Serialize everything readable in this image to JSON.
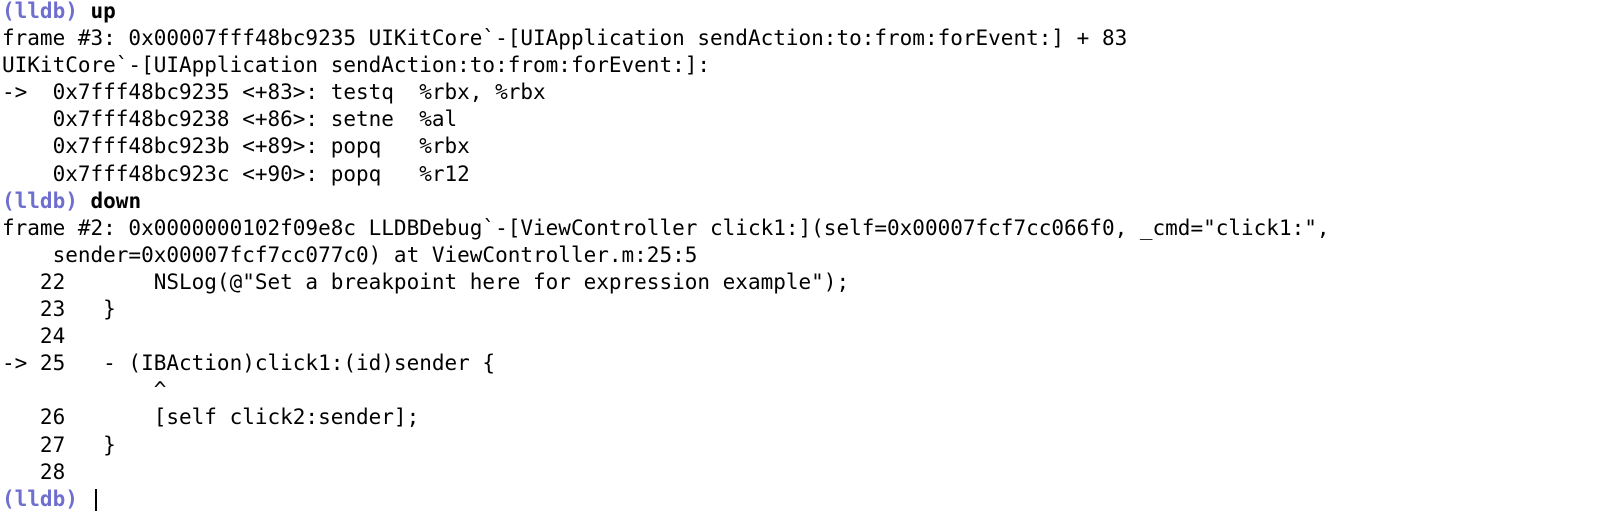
{
  "colors": {
    "prompt": "#6f6fcf",
    "text": "#000000",
    "background": "#ffffff"
  },
  "console": {
    "lines": [
      {
        "type": "prompt",
        "prompt": "(lldb)",
        "command": "up"
      },
      {
        "type": "output",
        "text": "frame #3: 0x00007fff48bc9235 UIKitCore`-[UIApplication sendAction:to:from:forEvent:] + 83"
      },
      {
        "type": "output",
        "text": "UIKitCore`-[UIApplication sendAction:to:from:forEvent:]:"
      },
      {
        "type": "output",
        "text": "->  0x7fff48bc9235 <+83>: testq  %rbx, %rbx"
      },
      {
        "type": "output",
        "text": "    0x7fff48bc9238 <+86>: setne  %al"
      },
      {
        "type": "output",
        "text": "    0x7fff48bc923b <+89>: popq   %rbx"
      },
      {
        "type": "output",
        "text": "    0x7fff48bc923c <+90>: popq   %r12"
      },
      {
        "type": "prompt",
        "prompt": "(lldb)",
        "command": "down"
      },
      {
        "type": "output",
        "text": "frame #2: 0x0000000102f09e8c LLDBDebug`-[ViewController click1:](self=0x00007fcf7cc066f0, _cmd=\"click1:\","
      },
      {
        "type": "output",
        "text": "    sender=0x00007fcf7cc077c0) at ViewController.m:25:5"
      },
      {
        "type": "output",
        "text": "   22   \t    NSLog(@\"Set a breakpoint here for expression example\");"
      },
      {
        "type": "output",
        "text": "   23   \t}"
      },
      {
        "type": "output",
        "text": "   24   \t"
      },
      {
        "type": "output",
        "text": "-> 25   \t- (IBAction)click1:(id)sender {"
      },
      {
        "type": "output",
        "text": "        \t    ^"
      },
      {
        "type": "output",
        "text": "   26   \t    [self click2:sender];"
      },
      {
        "type": "output",
        "text": "   27   \t}"
      },
      {
        "type": "output",
        "text": "   28   \t"
      },
      {
        "type": "prompt",
        "prompt": "(lldb)",
        "command": ""
      }
    ]
  }
}
